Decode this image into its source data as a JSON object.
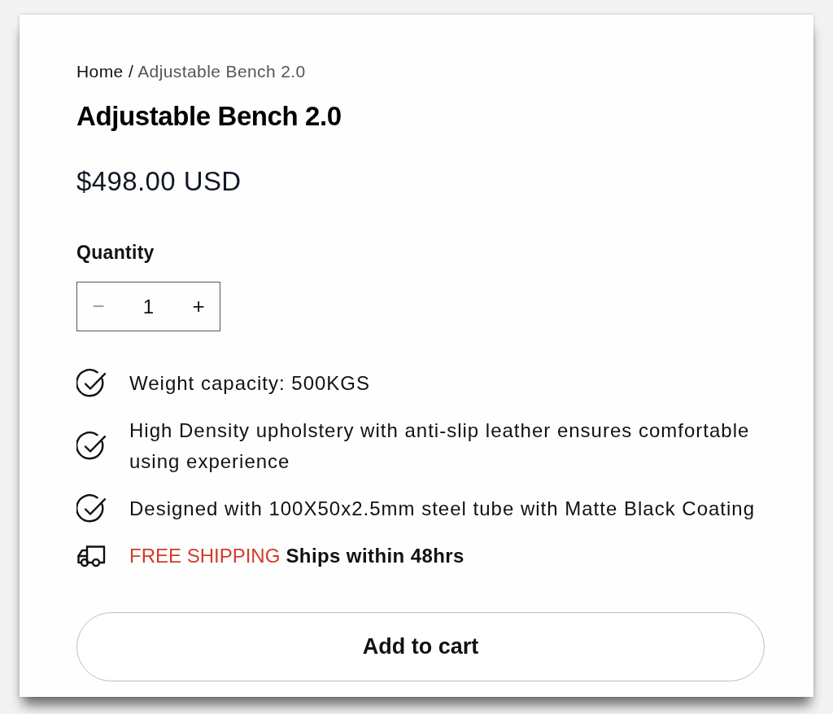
{
  "breadcrumb": [
    {
      "label": "Home",
      "current": false
    },
    {
      "label": "Adjustable Bench 2.0",
      "current": true
    }
  ],
  "breadcrumb_separator": "/",
  "product": {
    "title": "Adjustable Bench 2.0",
    "price": "$498.00 USD"
  },
  "quantity": {
    "label": "Quantity",
    "value": "1",
    "decrease": {
      "symbol": "−",
      "disabled": true
    },
    "increase": {
      "symbol": "+",
      "disabled": false
    }
  },
  "features": [
    {
      "kind": "check",
      "text": "Weight capacity: 500KGS"
    },
    {
      "kind": "check",
      "text": "High Density upholstery with anti-slip leather ensures comfortable using experience"
    },
    {
      "kind": "check",
      "text": "Designed with 100X50x2.5mm steel tube with Matte Black Coating"
    },
    {
      "kind": "shipping",
      "highlight": "FREE SHIPPING",
      "text": "Ships within 48hrs"
    }
  ],
  "button": {
    "label": "Add to cart"
  }
}
